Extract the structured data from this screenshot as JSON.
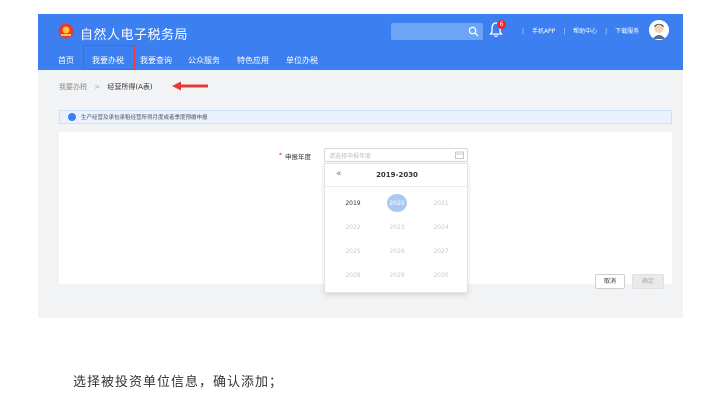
{
  "header": {
    "brand": "自然人电子税务局",
    "bell_badge": "6",
    "links": [
      "手机APP",
      "帮助中心",
      "下载服务"
    ]
  },
  "nav": {
    "items": [
      "首页",
      "我要办税",
      "我要查询",
      "公众服务",
      "特色应用",
      "单位办税"
    ]
  },
  "breadcrumb": {
    "parent": "我要办税",
    "separator": ">",
    "current": "经营所得(A表)"
  },
  "notice": {
    "text": "生产经营及承包承租经营所得月度或者季度预缴申报"
  },
  "form": {
    "required_mark": "*",
    "year_label": "申报年度",
    "year_placeholder": "请选择申报年度"
  },
  "picker": {
    "prev": "«",
    "range_title": "2019-2030",
    "years": [
      "2019",
      "2020",
      "2021",
      "2022",
      "2023",
      "2024",
      "2025",
      "2026",
      "2027",
      "2028",
      "2029",
      "2030"
    ],
    "selected": "2020"
  },
  "buttons": {
    "cancel": "取消",
    "confirm": "确定"
  },
  "caption": "选择被投资单位信息，确认添加；",
  "colors": {
    "header_blue": "#3b7ff0",
    "highlight_red": "#e53935",
    "selected_year": "#a9c9f4"
  }
}
